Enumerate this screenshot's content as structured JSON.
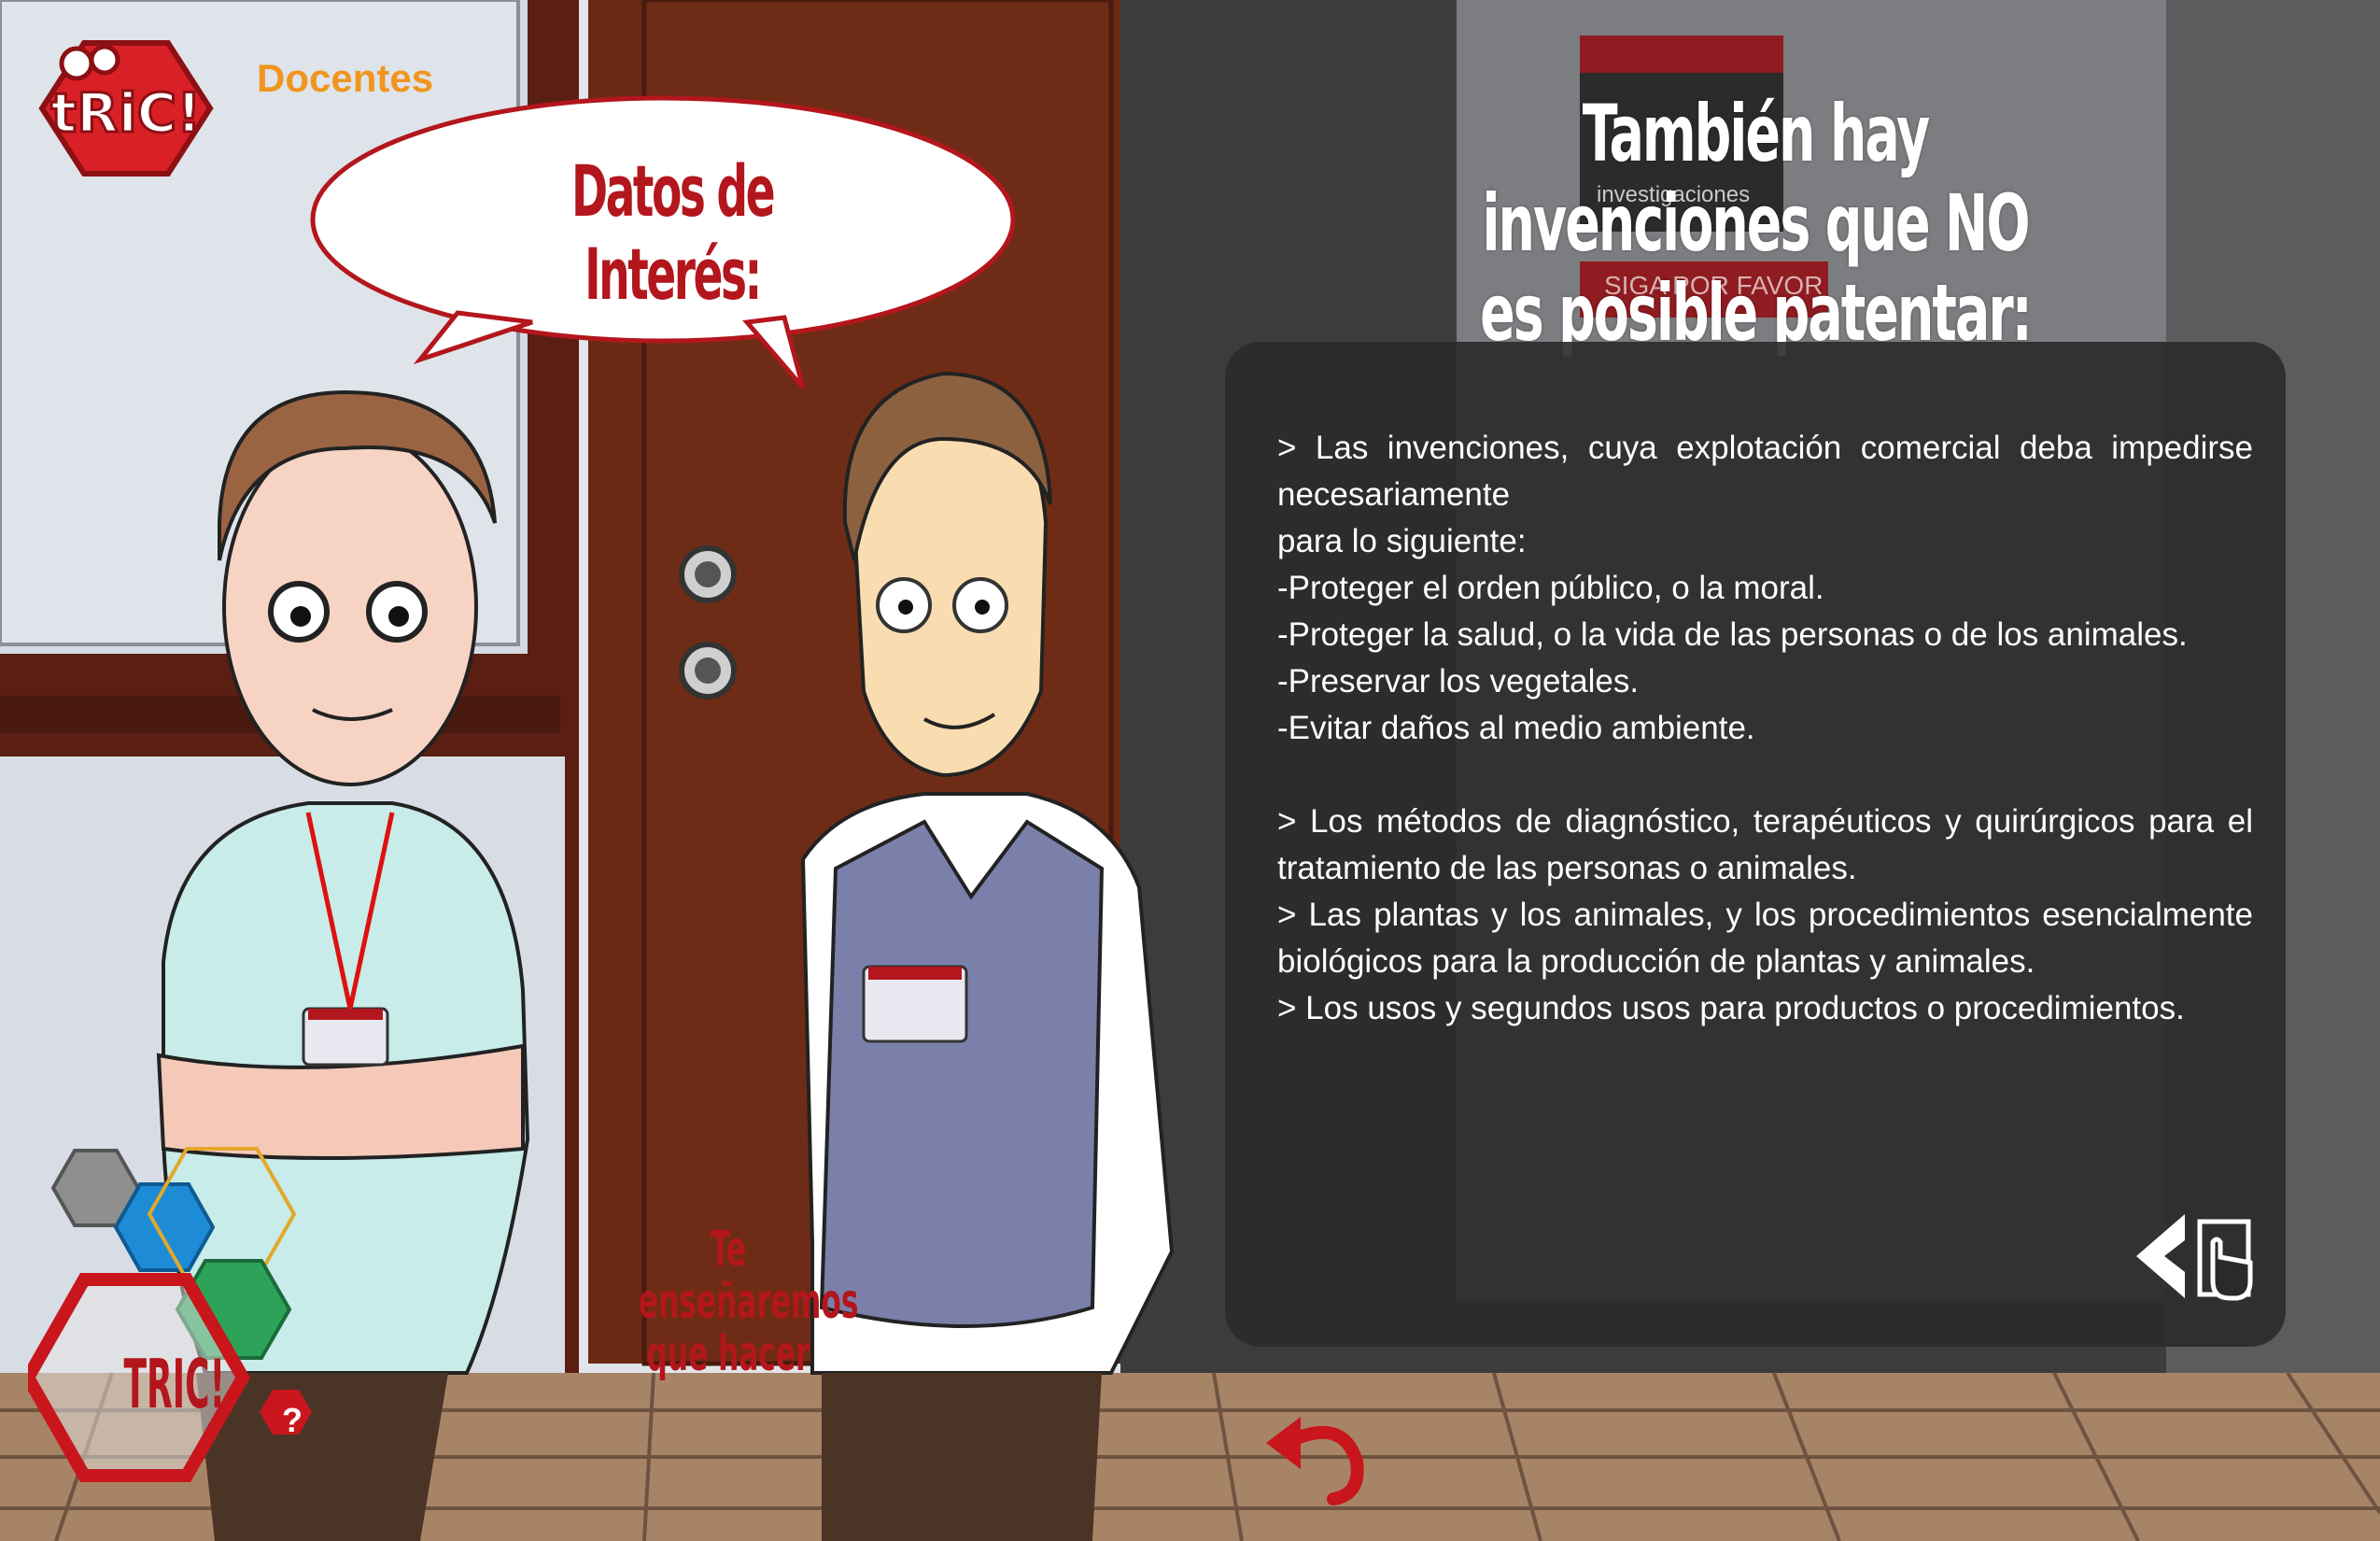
{
  "header": {
    "logo_text": "tRiC!",
    "section_label": "Docentes"
  },
  "speech_bubble": {
    "title": "Datos de Interés:"
  },
  "headline": "También hay invenciones que NO es posible patentar:",
  "info_panel": {
    "text": "> Las invenciones, cuya explotación comercial deba impedirse necesariamente\npara lo siguiente:\n-Proteger el orden público, o la moral.\n-Proteger la salud, o la vida de las personas o de los animales.\n-Preservar los vegetales.\n-Evitar daños al medio ambiente.\n\n> Los métodos de diagnóstico, terapéuticos y quirúrgicos para el tratamiento de las personas o animales.\n> Las plantas y los animales, y los procedimientos esencialmente biológicos para la producción de plantas y animales.\n> Los usos y segundos usos para productos o procedimientos."
  },
  "background_sign": {
    "line1": "investigaciones",
    "line2": "SIGA POR FAVOR"
  },
  "tagline": "Te enseñaremos que hacer",
  "hex_menu": {
    "label": "TRIC!",
    "help": "?"
  },
  "colors": {
    "brand_red": "#b3161c",
    "accent_orange": "#f0951e",
    "panel": "#2a2a2a",
    "wall": "#e2e5ea",
    "door": "#6b2a14",
    "floor": "#a88466"
  },
  "icons": {
    "back": "curved-back-arrow-icon",
    "nav": "chevron-left-hand-cursor-icon"
  }
}
